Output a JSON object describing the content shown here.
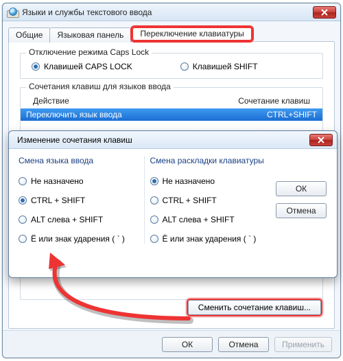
{
  "parent": {
    "title": "Языки и службы текстового ввода",
    "tabs": [
      "Общие",
      "Языковая панель",
      "Переключение клавиатуры"
    ],
    "active_tab": 2,
    "capslock": {
      "legend": "Отключение режима Caps Lock",
      "opt_caps": "Клавишей CAPS LOCK",
      "opt_shift": "Клавишей SHIFT"
    },
    "hotkeys": {
      "legend": "Сочетания клавиш для языков ввода",
      "col_action": "Действие",
      "col_keys": "Сочетание клавиш",
      "row_action": "Переключить язык ввода",
      "row_keys": "CTRL+SHIFT"
    },
    "change_btn": "Сменить сочетание клавиш...",
    "buttons": {
      "ok": "ОК",
      "cancel": "Отмена",
      "apply": "Применить"
    }
  },
  "dialog": {
    "title": "Изменение сочетания клавиш",
    "left_title": "Смена языка ввода",
    "right_title": "Смена раскладки клавиатуры",
    "options": {
      "none": "Не назначено",
      "ctrl_shift": "CTRL + SHIFT",
      "alt_shift": "ALT слева + SHIFT",
      "yo": "Ё или знак ударения ( ` )"
    },
    "buttons": {
      "ok": "ОК",
      "cancel": "Отмена"
    }
  }
}
